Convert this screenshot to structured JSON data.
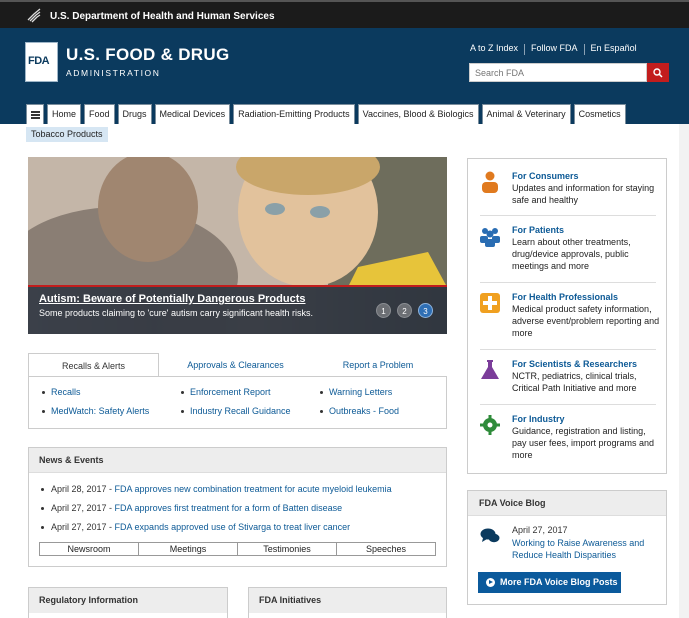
{
  "hhs_bar": {
    "text": "U.S. Department of Health and Human Services"
  },
  "header": {
    "logo_text": "FDA",
    "title": "U.S. FOOD & DRUG",
    "subtitle": "ADMINISTRATION",
    "util_links": [
      "A to Z Index",
      "Follow FDA",
      "En Español"
    ],
    "search_placeholder": "Search FDA"
  },
  "nav": {
    "items": [
      "Home",
      "Food",
      "Drugs",
      "Medical Devices",
      "Radiation-Emitting Products",
      "Vaccines, Blood & Biologics",
      "Animal & Veterinary",
      "Cosmetics"
    ],
    "second_row": "Tobacco Products"
  },
  "hero": {
    "title": "Autism: Beware of Potentially Dangerous Products",
    "subtitle": "Some products claiming to 'cure' autism carry significant health risks.",
    "slides": [
      "1",
      "2",
      "3"
    ],
    "active_slide": 3
  },
  "recalls": {
    "tabs": [
      "Recalls & Alerts",
      "Approvals & Clearances",
      "Report a Problem"
    ],
    "col1": [
      "Recalls",
      "MedWatch: Safety Alerts"
    ],
    "col2": [
      "Enforcement Report",
      "Industry Recall Guidance"
    ],
    "col3": [
      "Warning Letters",
      "Outbreaks - Food"
    ]
  },
  "news": {
    "title": "News & Events",
    "items": [
      {
        "date": "April 28, 2017 - ",
        "text": "FDA approves new combination treatment for acute myeloid leukemia"
      },
      {
        "date": "April 27, 2017 - ",
        "text": "FDA approves first treatment for a form of Batten disease"
      },
      {
        "date": "April 27, 2017 - ",
        "text": "FDA expands approved use of Stivarga to treat liver cancer"
      }
    ],
    "tabs": [
      "Newsroom",
      "Meetings",
      "Testimonies",
      "Speeches"
    ]
  },
  "audiences": [
    {
      "title": "For Consumers",
      "desc": "Updates and information for staying safe and healthy",
      "color": "#e07a1f"
    },
    {
      "title": "For Patients",
      "desc": "Learn about other treatments, drug/device approvals, public meetings and more",
      "color": "#2a6db3"
    },
    {
      "title": "For Health Professionals",
      "desc": "Medical product safety information, adverse event/problem reporting and more",
      "color": "#f0a020"
    },
    {
      "title": "For Scientists & Researchers",
      "desc": "NCTR, pediatrics, clinical trials, Critical Path Initiative and more",
      "color": "#7b3d9a"
    },
    {
      "title": "For Industry",
      "desc": "Guidance, registration and listing, pay user fees, import programs and more",
      "color": "#2e8b3a"
    }
  ],
  "blog": {
    "title": "FDA Voice Blog",
    "date": "April 27, 2017",
    "link": "Working to Raise Awareness and Reduce Health Disparities",
    "button": "More FDA Voice Blog Posts"
  },
  "bottom": {
    "left_title": "Regulatory Information",
    "right_title": "FDA Initiatives"
  }
}
